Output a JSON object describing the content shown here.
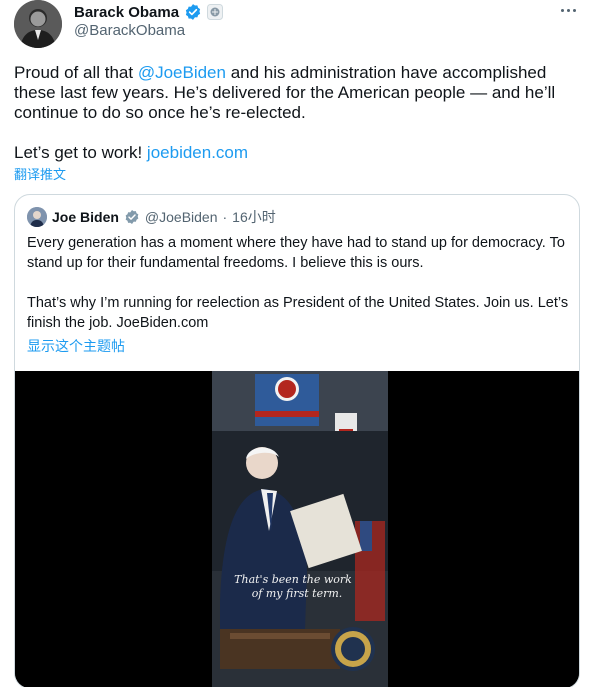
{
  "author": {
    "name": "Barack Obama",
    "handle": "@BarackObama",
    "verified_icon": "verified-badge-icon",
    "affiliation_icon": "government-seal-icon"
  },
  "tweet": {
    "text_pre": "Proud of all that ",
    "mention": "@JoeBiden",
    "text_post": " and his administration have accomplished these last few years. He’s delivered for the American people — and he’ll continue to do so once he’s re-elected.",
    "cta_text": "Let’s get to work! ",
    "cta_link": "joebiden.com",
    "translate_label": "翻译推文"
  },
  "quoted": {
    "name": "Joe Biden",
    "handle": "@JoeBiden",
    "separator": "·",
    "time": "16小时",
    "paragraph1": "Every generation has a moment where they have had to stand up for democracy. To stand up for their fundamental freedoms. I believe this is ours.",
    "paragraph2": "That’s why I’m running for reelection as President of the United States. Join us. Let’s finish the job. JoeBiden.com",
    "show_thread_label": "显示这个主题帖",
    "video_caption_line1": "That's been the work",
    "video_caption_line2": "of my first term."
  },
  "colors": {
    "link": "#1d9bf0",
    "text": "#0f1419",
    "secondary": "#536471",
    "border": "#cfd9de"
  }
}
